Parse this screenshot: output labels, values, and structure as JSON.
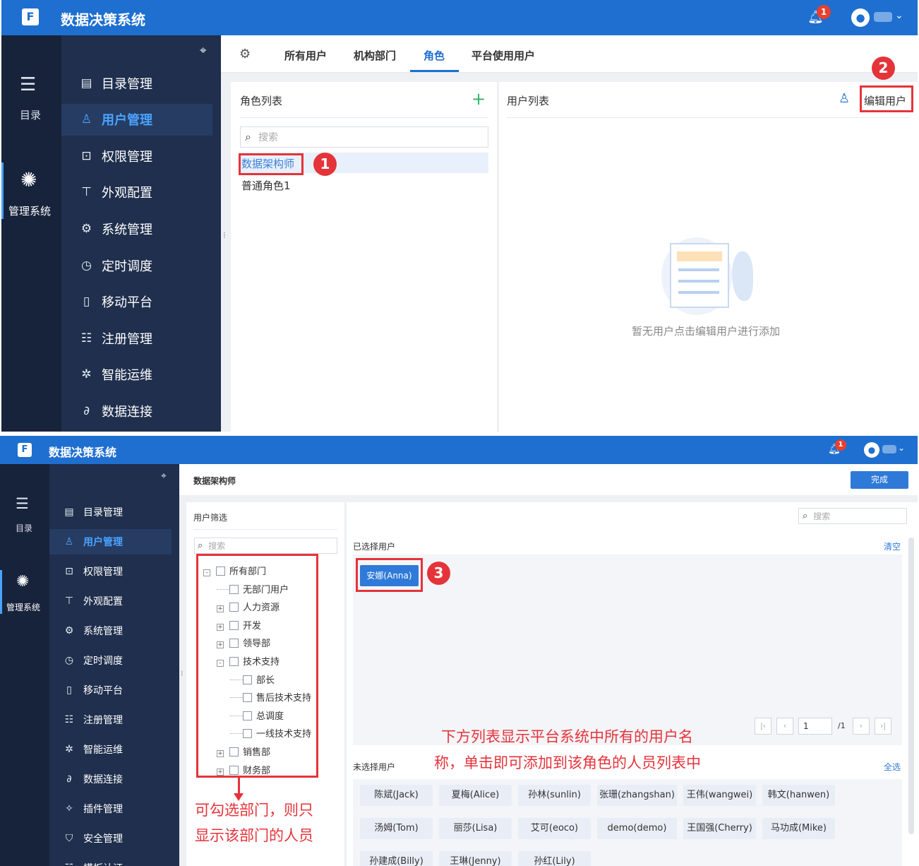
{
  "app": {
    "title": "数据决策系统",
    "notification_count": "1"
  },
  "iconbar": {
    "catalog_label": "目录",
    "admin_label": "管理系统"
  },
  "sidebar": {
    "items": [
      {
        "label": "目录管理",
        "icon": "catalog-icon"
      },
      {
        "label": "用户管理",
        "icon": "user-icon"
      },
      {
        "label": "权限管理",
        "icon": "lock-icon"
      },
      {
        "label": "外观配置",
        "icon": "paint-roller-icon"
      },
      {
        "label": "系统管理",
        "icon": "gear-icon"
      },
      {
        "label": "定时调度",
        "icon": "timer-icon"
      },
      {
        "label": "移动平台",
        "icon": "mobile-icon"
      },
      {
        "label": "注册管理",
        "icon": "register-icon"
      },
      {
        "label": "智能运维",
        "icon": "ops-icon"
      },
      {
        "label": "数据连接",
        "icon": "link-icon"
      },
      {
        "label": "插件管理",
        "icon": "plugin-icon"
      },
      {
        "label": "安全管理",
        "icon": "shield-icon"
      },
      {
        "label": "模板认证",
        "icon": "template-icon"
      }
    ]
  },
  "tabs": [
    "所有用户",
    "机构部门",
    "角色",
    "平台使用用户"
  ],
  "role_panel": {
    "title": "角色列表",
    "search_placeholder": "搜索",
    "roles": [
      "数据架构师",
      "普通角色1"
    ]
  },
  "user_panel": {
    "title": "用户列表",
    "edit_button": "编辑用户",
    "empty_text": "暂无用户点击编辑用户进行添加"
  },
  "editor": {
    "role_name": "数据架构师",
    "done_button": "完成",
    "filter_title": "用户筛选",
    "filter_search_placeholder": "搜索",
    "tree": [
      {
        "label": "所有部门",
        "level": 0,
        "toggle": "-"
      },
      {
        "label": "无部门用户",
        "level": 1,
        "toggle": ""
      },
      {
        "label": "人力资源",
        "level": 1,
        "toggle": "+"
      },
      {
        "label": "开发",
        "level": 1,
        "toggle": "+"
      },
      {
        "label": "领导部",
        "level": 1,
        "toggle": "+"
      },
      {
        "label": "技术支持",
        "level": 1,
        "toggle": "-"
      },
      {
        "label": "部长",
        "level": 2,
        "toggle": ""
      },
      {
        "label": "售后技术支持",
        "level": 2,
        "toggle": ""
      },
      {
        "label": "总调度",
        "level": 2,
        "toggle": ""
      },
      {
        "label": "一线技术支持",
        "level": 2,
        "toggle": ""
      },
      {
        "label": "销售部",
        "level": 1,
        "toggle": "+"
      },
      {
        "label": "财务部",
        "level": 1,
        "toggle": "+"
      }
    ],
    "right_search_placeholder": "搜索",
    "selected_title": "已选择用户",
    "clear_label": "清空",
    "selected_users": [
      "安娜(Anna)"
    ],
    "pagination": {
      "page": "1",
      "total": "/1"
    },
    "unselected_title": "未选择用户",
    "select_all_label": "全选",
    "unselected_users": [
      [
        "陈斌(Jack)",
        "夏梅(Alice)",
        "孙林(sunlin)",
        "张珊(zhangshan)",
        "王伟(wangwei)",
        "韩文(hanwen)"
      ],
      [
        "汤姆(Tom)",
        "丽莎(Lisa)",
        "艾可(eoco)",
        "demo(demo)",
        "王国强(Cherry)",
        "马功成(Mike)"
      ],
      [
        "孙建成(Billy)",
        "王琳(Jenny)",
        "孙红(Lily)"
      ]
    ]
  },
  "annotations": {
    "step1": "1",
    "step2": "2",
    "step3": "3",
    "note_list_line1": "下方列表显示平台系统中所有的用户名",
    "note_list_line2": "称，单击即可添加到该角色的人员列表中",
    "note_dept_line1": "可勾选部门，则只",
    "note_dept_line2": "显示该部门的人员"
  },
  "colors": {
    "primary": "#1e6fd0",
    "sidebar": "#1f2f4d",
    "annotation": "#e5333a"
  }
}
